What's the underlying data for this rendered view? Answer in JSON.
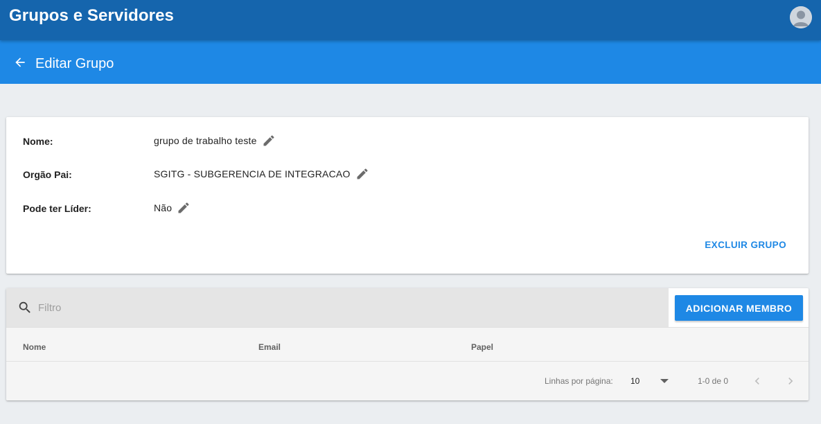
{
  "app": {
    "title": "Grupos e Servidores"
  },
  "subheader": {
    "title": "Editar Grupo"
  },
  "group": {
    "fields": [
      {
        "label": "Nome:",
        "value": "grupo de trabalho teste"
      },
      {
        "label": "Orgão Pai:",
        "value": "SGITG - SUBGERENCIA DE INTEGRACAO"
      },
      {
        "label": "Pode ter Líder:",
        "value": "Não"
      }
    ],
    "delete_label": "EXCLUIR GRUPO"
  },
  "members": {
    "filter_placeholder": "Filtro",
    "add_label": "ADICIONAR MEMBRO",
    "columns": [
      "Nome",
      "Email",
      "Papel"
    ],
    "rows_per_page_label": "Linhas por página:",
    "rows_per_page_value": "10",
    "range_text": "1-0 de 0"
  },
  "colors": {
    "topbar": "#1565ad",
    "subbar": "#1e88e5",
    "accent": "#1e88e5"
  },
  "icons": {
    "back": "arrow-left-icon",
    "edit": "pencil-icon",
    "search": "search-icon",
    "avatar": "user-avatar-icon",
    "dropdown": "caret-down-icon",
    "prev": "chevron-left-icon",
    "next": "chevron-right-icon"
  }
}
